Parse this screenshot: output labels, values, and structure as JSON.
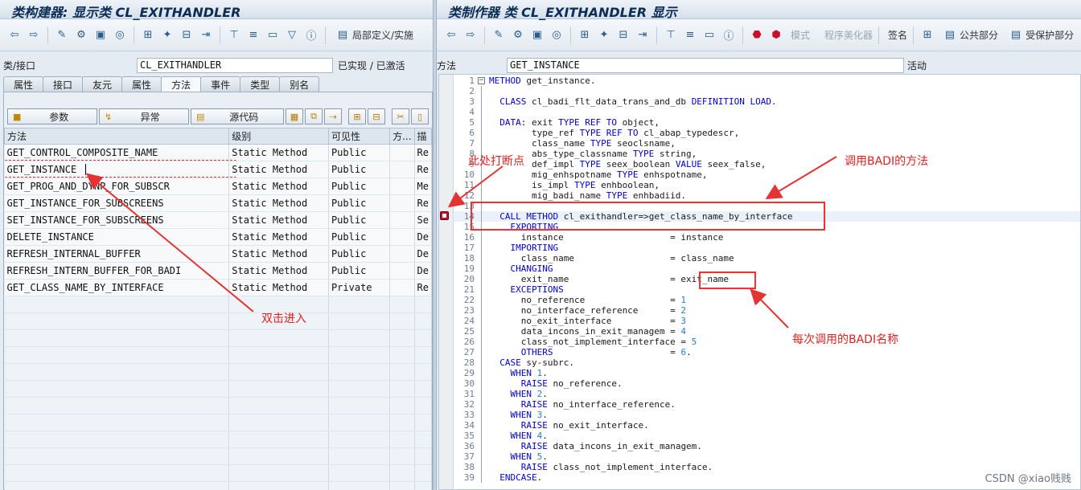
{
  "left": {
    "title": "类构建器: 显示类 CL_EXITHANDLER",
    "toolbar_text": "局部定义/实施",
    "class_label": "类/接口",
    "class_value": "CL_EXITHANDLER",
    "status": "已实现 / 已激活",
    "tabs": [
      "属性",
      "接口",
      "友元",
      "属性",
      "方法",
      "事件",
      "类型",
      "别名"
    ],
    "active_tab": "方法",
    "buttons": {
      "params": "参数",
      "exceptions": "异常",
      "source": "源代码"
    },
    "columns": [
      "方法",
      "级别",
      "可见性",
      "方...",
      "描"
    ],
    "rows": [
      {
        "name": "GET_CONTROL_COMPOSITE_NAME",
        "level": "Static Method",
        "vis": "Public",
        "desc": "Re"
      },
      {
        "name": "GET_INSTANCE",
        "level": "Static Method",
        "vis": "Public",
        "desc": "Re"
      },
      {
        "name": "GET_PROG_AND_DYNP_FOR_SUBSCR",
        "level": "Static Method",
        "vis": "Public",
        "desc": "Me"
      },
      {
        "name": "GET_INSTANCE_FOR_SUBSCREENS",
        "level": "Static Method",
        "vis": "Public",
        "desc": "Re"
      },
      {
        "name": "SET_INSTANCE_FOR_SUBSCREENS",
        "level": "Static Method",
        "vis": "Public",
        "desc": "Se"
      },
      {
        "name": "DELETE_INSTANCE",
        "level": "Static Method",
        "vis": "Public",
        "desc": "De"
      },
      {
        "name": "REFRESH_INTERNAL_BUFFER",
        "level": "Static Method",
        "vis": "Public",
        "desc": "De"
      },
      {
        "name": "REFRESH_INTERN_BUFFER_FOR_BADI",
        "level": "Static Method",
        "vis": "Public",
        "desc": "De"
      },
      {
        "name": "GET_CLASS_NAME_BY_INTERFACE",
        "level": "Static Method",
        "vis": "Private",
        "desc": "Re"
      }
    ]
  },
  "right": {
    "title": "类制作器 类 CL_EXITHANDLER 显示",
    "toolbar": {
      "mode": "模式",
      "pretty": "程序美化器",
      "sign": "签名",
      "public": "公共部分",
      "protected": "受保护部分"
    },
    "method_label": "方法",
    "method_value": "GET_INSTANCE",
    "status": "活动"
  },
  "code_lines": [
    [
      [
        "kw",
        "METHOD"
      ],
      [
        "t",
        " get_instance."
      ]
    ],
    [],
    [
      [
        "t",
        "  "
      ],
      [
        "kw",
        "CLASS"
      ],
      [
        "t",
        " cl_badi_flt_data_trans_and_db "
      ],
      [
        "kw",
        "DEFINITION LOAD"
      ],
      [
        "t",
        "."
      ]
    ],
    [],
    [
      [
        "t",
        "  "
      ],
      [
        "kw",
        "DATA"
      ],
      [
        "t",
        ": exit "
      ],
      [
        "kw",
        "TYPE REF TO"
      ],
      [
        "t",
        " object,"
      ]
    ],
    [
      [
        "t",
        "        type_ref "
      ],
      [
        "kw",
        "TYPE REF TO"
      ],
      [
        "t",
        " cl_abap_typedescr,"
      ]
    ],
    [
      [
        "t",
        "        class_name "
      ],
      [
        "kw",
        "TYPE"
      ],
      [
        "t",
        " seoclsname,"
      ]
    ],
    [
      [
        "t",
        "        abs_type_classname "
      ],
      [
        "kw",
        "TYPE"
      ],
      [
        "t",
        " string,"
      ]
    ],
    [
      [
        "t",
        "        def_impl "
      ],
      [
        "kw",
        "TYPE"
      ],
      [
        "t",
        " seex_boolean "
      ],
      [
        "kw",
        "VALUE"
      ],
      [
        "t",
        " seex_false,"
      ]
    ],
    [
      [
        "t",
        "        mig_enhspotname "
      ],
      [
        "kw",
        "TYPE"
      ],
      [
        "t",
        " enhspotname,"
      ]
    ],
    [
      [
        "t",
        "        is_impl "
      ],
      [
        "kw",
        "TYPE"
      ],
      [
        "t",
        " enhboolean,"
      ]
    ],
    [
      [
        "t",
        "        mig_badi_name "
      ],
      [
        "kw",
        "TYPE"
      ],
      [
        "t",
        " enhbadiid."
      ]
    ],
    [],
    [
      [
        "t",
        "  "
      ],
      [
        "kw",
        "CALL METHOD"
      ],
      [
        "t",
        " cl_exithandler=>get_class_name_by_interface"
      ]
    ],
    [
      [
        "t",
        "    "
      ],
      [
        "kw",
        "EXPORTING"
      ]
    ],
    [
      [
        "t",
        "      instance                    = instance"
      ]
    ],
    [
      [
        "t",
        "    "
      ],
      [
        "kw",
        "IMPORTING"
      ]
    ],
    [
      [
        "t",
        "      class_name                  = class_name"
      ]
    ],
    [
      [
        "t",
        "    "
      ],
      [
        "kw",
        "CHANGING"
      ]
    ],
    [
      [
        "t",
        "      exit_name                   = exit_name"
      ]
    ],
    [
      [
        "t",
        "    "
      ],
      [
        "kw",
        "EXCEPTIONS"
      ]
    ],
    [
      [
        "t",
        "      no_reference                = "
      ],
      [
        "num",
        "1"
      ]
    ],
    [
      [
        "t",
        "      no_interface_reference      = "
      ],
      [
        "num",
        "2"
      ]
    ],
    [
      [
        "t",
        "      no_exit_interface           = "
      ],
      [
        "num",
        "3"
      ]
    ],
    [
      [
        "t",
        "      data_incons_in_exit_managem = "
      ],
      [
        "num",
        "4"
      ]
    ],
    [
      [
        "t",
        "      class_not_implement_interface = "
      ],
      [
        "num",
        "5"
      ]
    ],
    [
      [
        "t",
        "      "
      ],
      [
        "kw",
        "OTHERS"
      ],
      [
        "t",
        "                      = "
      ],
      [
        "num",
        "6"
      ],
      [
        "t",
        "."
      ]
    ],
    [
      [
        "t",
        "  "
      ],
      [
        "kw",
        "CASE"
      ],
      [
        "t",
        " sy-subrc."
      ]
    ],
    [
      [
        "t",
        "    "
      ],
      [
        "kw",
        "WHEN"
      ],
      [
        "t",
        " "
      ],
      [
        "num",
        "1"
      ],
      [
        "t",
        "."
      ]
    ],
    [
      [
        "t",
        "      "
      ],
      [
        "kw",
        "RAISE"
      ],
      [
        "t",
        " no_reference."
      ]
    ],
    [
      [
        "t",
        "    "
      ],
      [
        "kw",
        "WHEN"
      ],
      [
        "t",
        " "
      ],
      [
        "num",
        "2"
      ],
      [
        "t",
        "."
      ]
    ],
    [
      [
        "t",
        "      "
      ],
      [
        "kw",
        "RAISE"
      ],
      [
        "t",
        " no_interface_reference."
      ]
    ],
    [
      [
        "t",
        "    "
      ],
      [
        "kw",
        "WHEN"
      ],
      [
        "t",
        " "
      ],
      [
        "num",
        "3"
      ],
      [
        "t",
        "."
      ]
    ],
    [
      [
        "t",
        "      "
      ],
      [
        "kw",
        "RAISE"
      ],
      [
        "t",
        " no_exit_interface."
      ]
    ],
    [
      [
        "t",
        "    "
      ],
      [
        "kw",
        "WHEN"
      ],
      [
        "t",
        " "
      ],
      [
        "num",
        "4"
      ],
      [
        "t",
        "."
      ]
    ],
    [
      [
        "t",
        "      "
      ],
      [
        "kw",
        "RAISE"
      ],
      [
        "t",
        " data_incons_in_exit_managem."
      ]
    ],
    [
      [
        "t",
        "    "
      ],
      [
        "kw",
        "WHEN"
      ],
      [
        "t",
        " "
      ],
      [
        "num",
        "5"
      ],
      [
        "t",
        "."
      ]
    ],
    [
      [
        "t",
        "      "
      ],
      [
        "kw",
        "RAISE"
      ],
      [
        "t",
        " class_not_implement_interface."
      ]
    ],
    [
      [
        "t",
        "  "
      ],
      [
        "kw",
        "ENDCASE"
      ],
      [
        "t",
        "."
      ]
    ]
  ],
  "annotations": {
    "breakpoint": "此处打断点",
    "call_badi": "调用BADI的方法",
    "double_click": "双击进入",
    "badi_name": "每次调用的BADI名称"
  },
  "watermark": "CSDN @xiao贱贱",
  "colors": {
    "annotation": "#e33333",
    "keyword": "#0000d8",
    "number": "#2a7cc7"
  }
}
